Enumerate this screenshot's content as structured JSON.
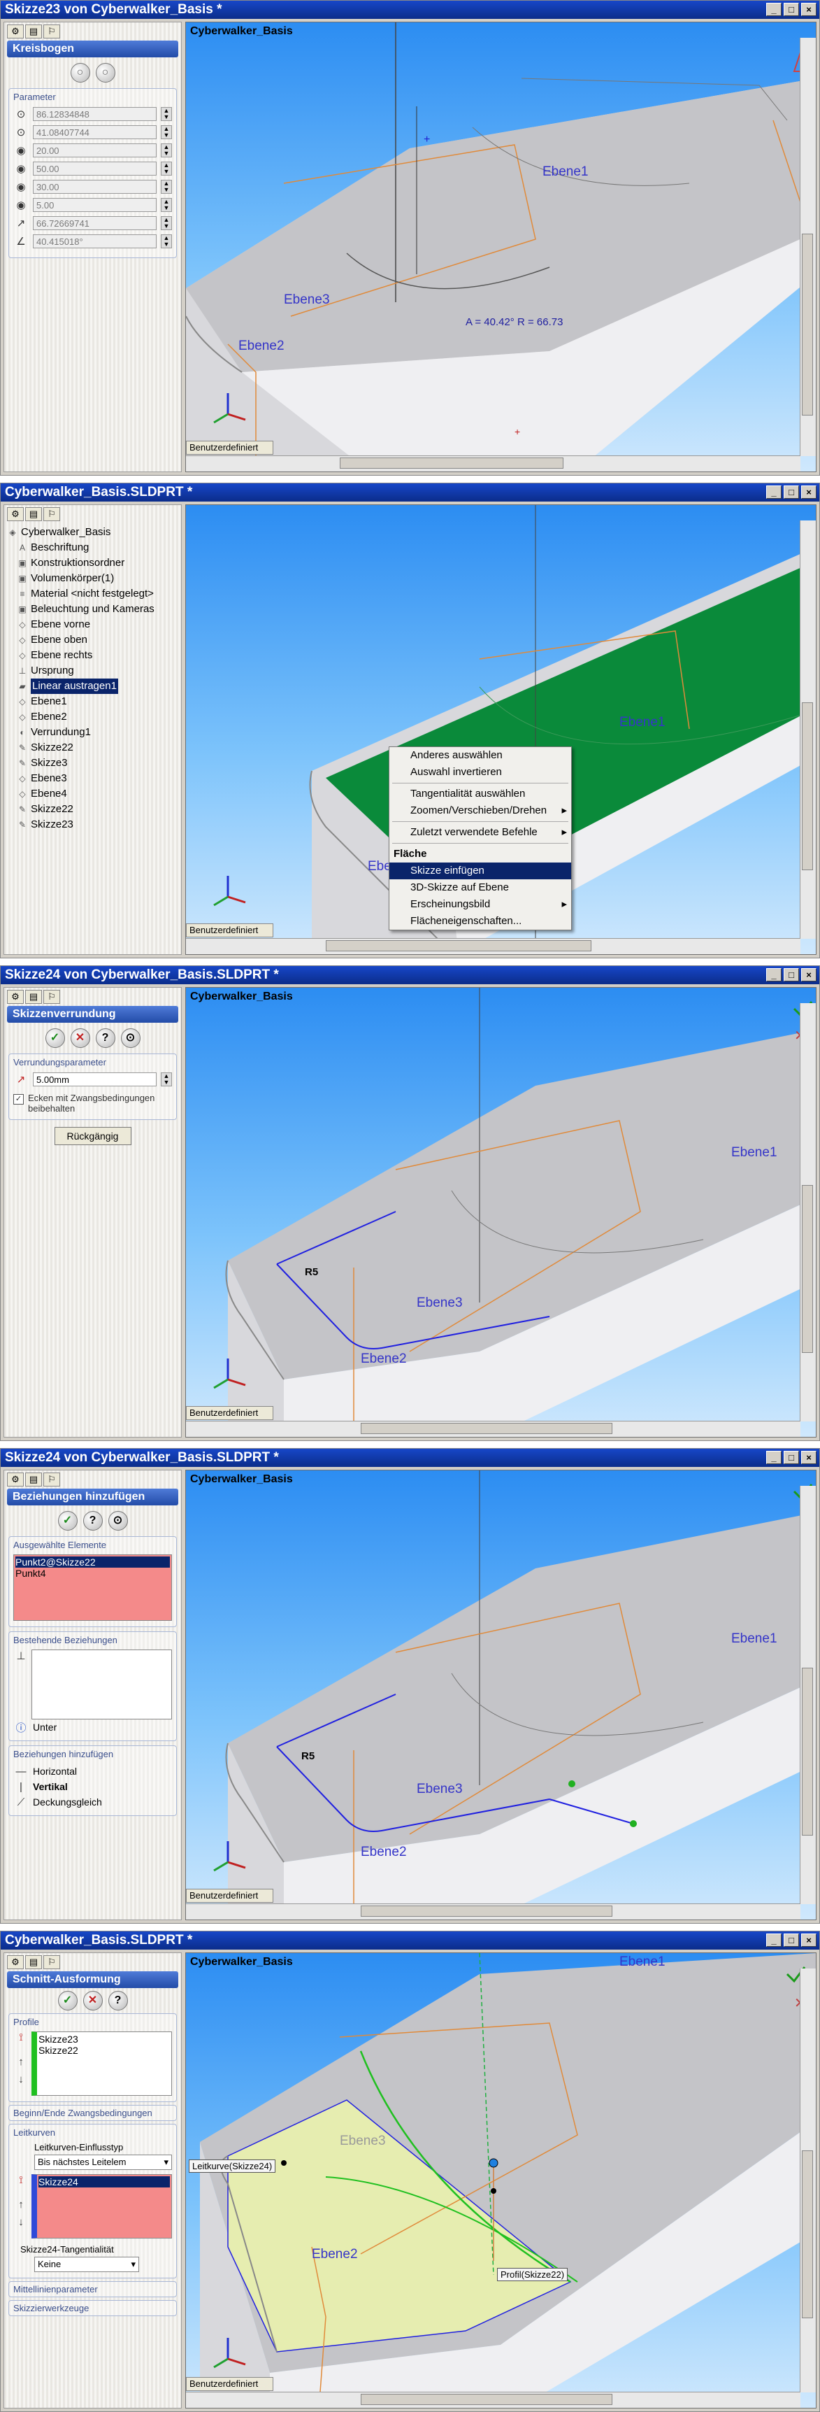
{
  "p1": {
    "title": "Skizze23 von Cyberwalker_Basis *",
    "pm_title": "Kreisbogen",
    "group": "Parameter",
    "params": [
      "86.12834848",
      "41.08407744",
      "20.00",
      "50.00",
      "30.00",
      "5.00",
      "66.72669741",
      "40.415018°"
    ],
    "view_title": "Cyberwalker_Basis",
    "plane1": "Ebene1",
    "plane2": "Ebene2",
    "plane3": "Ebene3",
    "dim_text": "A = 40.42°  R = 66.73",
    "status": "Benutzerdefiniert"
  },
  "p2": {
    "title": "Cyberwalker_Basis.SLDPRT *",
    "tree": [
      "Cyberwalker_Basis",
      "Beschriftung",
      "Konstruktionsordner",
      "Volumenkörper(1)",
      "Material <nicht festgelegt>",
      "Beleuchtung und Kameras",
      "Ebene vorne",
      "Ebene oben",
      "Ebene rechts",
      "Ursprung",
      "Linear austragen1",
      "Ebene1",
      "Ebene2",
      "Verrundung1",
      "Skizze22",
      "Skizze3",
      "Ebene3",
      "Ebene4",
      "Skizze22",
      "Skizze23"
    ],
    "menu": {
      "items_top": [
        "Anderes auswählen",
        "Auswahl invertieren"
      ],
      "items_mid": [
        "Tangentialität auswählen",
        "Zoomen/Verschieben/Drehen"
      ],
      "item_recent": "Zuletzt verwendete Befehle",
      "section": "Fläche",
      "items_face": [
        "Skizze einfügen",
        "3D-Skizze auf Ebene",
        "Erscheinungsbild",
        "Flächeneigenschaften..."
      ]
    },
    "plane1": "Ebene1",
    "plane2": "Ebe",
    "status": "Benutzerdefiniert"
  },
  "p3": {
    "title": "Skizze24 von Cyberwalker_Basis.SLDPRT *",
    "pm_title": "Skizzenverrundung",
    "group": "Verrundungsparameter",
    "value": "5.00mm",
    "checkbox": "Ecken mit Zwangsbedingungen beibehalten",
    "undo": "Rückgängig",
    "view_title": "Cyberwalker_Basis",
    "plane1": "Ebene1",
    "plane2": "Ebene2",
    "plane3": "Ebene3",
    "r_label": "R5",
    "status": "Benutzerdefiniert"
  },
  "p4": {
    "title": "Skizze24 von Cyberwalker_Basis.SLDPRT *",
    "pm_title": "Beziehungen hinzufügen",
    "group_sel": "Ausgewählte Elemente",
    "selected": [
      "Punkt2@Skizze22",
      "Punkt4"
    ],
    "group_exist": "Bestehende Beziehungen",
    "info": "Unter",
    "group_add": "Beziehungen hinzufügen",
    "relations": [
      "Horizontal",
      "Vertikal",
      "Deckungsgleich"
    ],
    "view_title": "Cyberwalker_Basis",
    "plane1": "Ebene1",
    "plane2": "Ebene2",
    "plane3": "Ebene3",
    "r_label": "R5",
    "status": "Benutzerdefiniert"
  },
  "p5": {
    "title": "Cyberwalker_Basis.SLDPRT *",
    "pm_title": "Schnitt-Ausformung",
    "group_profile": "Profile",
    "profiles": [
      "Skizze23",
      "Skizze22"
    ],
    "group_start": "Beginn/Ende Zwangsbedingungen",
    "group_guide": "Leitkurven",
    "guide_influence": "Leitkurven-Einflusstyp",
    "guide_influence_value": "Bis nächstes Leitelem",
    "guides": [
      "Skizze24"
    ],
    "tangency_label": "Skizze24-Tangentialität",
    "tangency_value": "Keine",
    "group_center": "Mittellinienparameter",
    "group_tools": "Skizzierwerkzeuge",
    "view_title": "Cyberwalker_Basis",
    "plane1": "Ebene1",
    "plane2": "Ebene2",
    "plane3": "Ebene3",
    "tag_guide": "Leitkurve(Skizze24)",
    "tag_profile": "Profil(Skizze22)",
    "status": "Benutzerdefiniert"
  }
}
